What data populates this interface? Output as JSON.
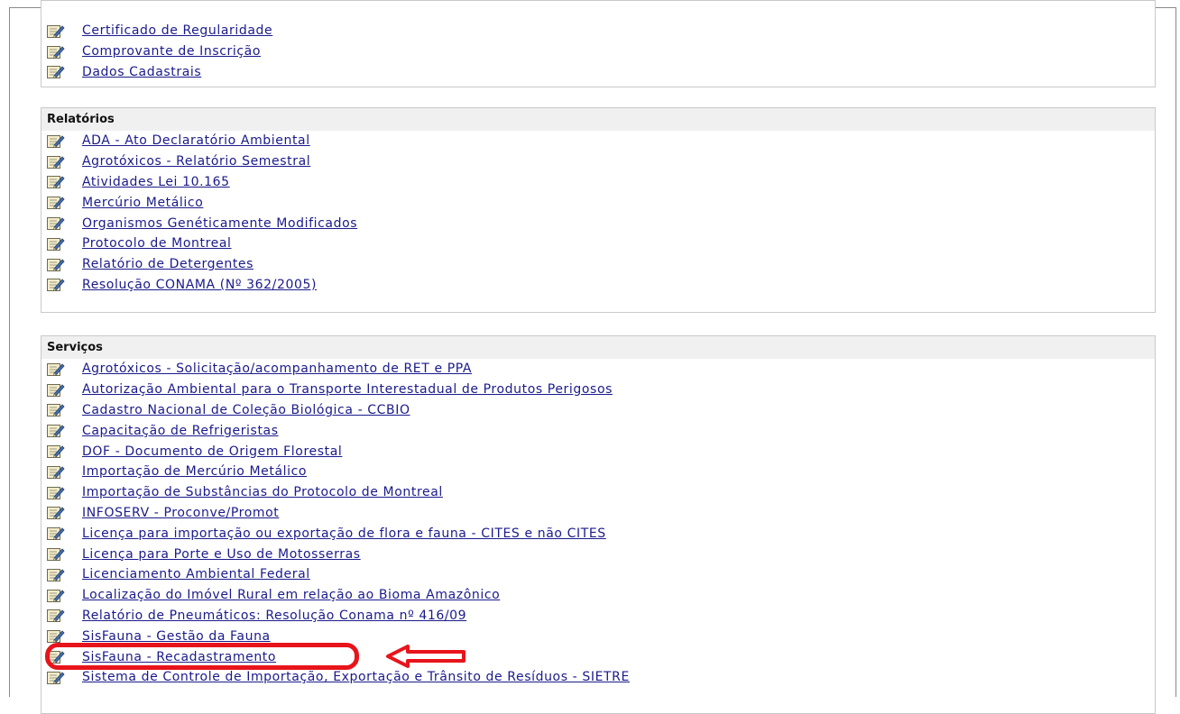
{
  "sections": [
    {
      "title": "",
      "links": [
        "Certificado de Regularidade",
        "Comprovante de Inscrição",
        "Dados Cadastrais"
      ]
    },
    {
      "title": "Relatórios",
      "links": [
        "ADA - Ato Declaratório Ambiental",
        "Agrotóxicos - Relatório Semestral",
        "Atividades Lei 10.165",
        "Mercúrio Metálico",
        "Organismos Genéticamente Modificados",
        "Protocolo de Montreal",
        "Relatório de Detergentes",
        "Resolução CONAMA (Nº 362/2005)"
      ]
    },
    {
      "title": "Serviços",
      "links": [
        "Agrotóxicos - Solicitação/acompanhamento de RET e PPA",
        "Autorização Ambiental para o Transporte Interestadual de Produtos Perigosos",
        "Cadastro Nacional de Coleção Biológica - CCBIO",
        "Capacitação de Refrigeristas",
        "DOF - Documento de Origem Florestal",
        "Importação de Mercúrio Metálico",
        "Importação de Substâncias do Protocolo de Montreal",
        "INFOSERV - Proconve/Promot",
        "Licença para importação ou exportação de flora e fauna - CITES e não CITES",
        "Licença para Porte e Uso de Motosserras",
        "Licenciamento Ambiental Federal",
        "Localização do Imóvel Rural em relação ao Bioma Amazônico",
        "Relatório de Pneumáticos: Resolução Conama nº 416/09",
        "SisFauna - Gestão da Fauna",
        "SisFauna - Recadastramento",
        "Sistema de Controle de Importação, Exportação e Trânsito de Resíduos - SIETRE"
      ]
    }
  ],
  "annotation": {
    "highlighted_link": "SisFauna - Gestão da Fauna",
    "color": "#e8141b"
  },
  "icons": {
    "link_icon": "edit-document-icon"
  }
}
